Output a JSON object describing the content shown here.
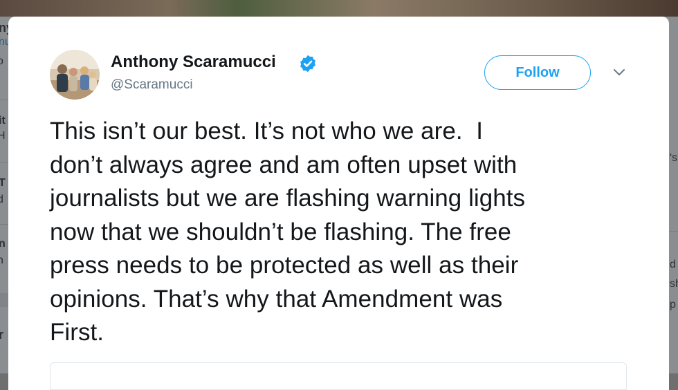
{
  "background": {
    "fragments_left": [
      "ny",
      "nu",
      "o",
      "it",
      "H",
      "T",
      "d",
      "n",
      "n",
      "r"
    ],
    "fragments_right": [
      "'s",
      "d",
      "sh",
      "p"
    ]
  },
  "tweet": {
    "author": {
      "name": "Anthony Scaramucci",
      "handle": "@Scaramucci",
      "verified": true
    },
    "follow_label": "Follow",
    "text": "This isn’t our best. It’s not who we are.  I\ndon’t always agree and am often upset with\njournalists but we are flashing warning lights\nnow that we shouldn’t be flashing. The free\npress needs to be protected as well as their\nopinions. That’s why that Amendment was\nFirst."
  },
  "colors": {
    "accent": "#1da1f2",
    "text": "#14171a",
    "secondary": "#657786"
  }
}
